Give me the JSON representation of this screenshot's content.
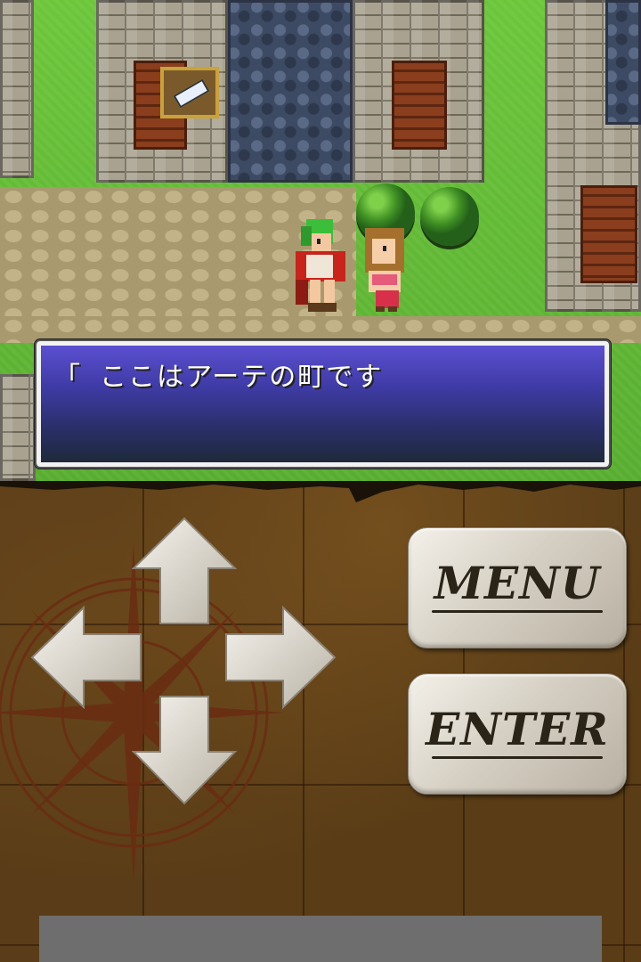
{
  "dialog": {
    "text": "「 ここはアーテの町です"
  },
  "controls": {
    "menu_label": "MENU",
    "enter_label": "ENTER",
    "dpad": [
      "up",
      "down",
      "left",
      "right"
    ]
  },
  "colors": {
    "dialog_top": "#5b4fd0",
    "dialog_bottom": "#1e2a3a",
    "grass": "#6cc63a",
    "panel_bg": "#5a3d18"
  }
}
